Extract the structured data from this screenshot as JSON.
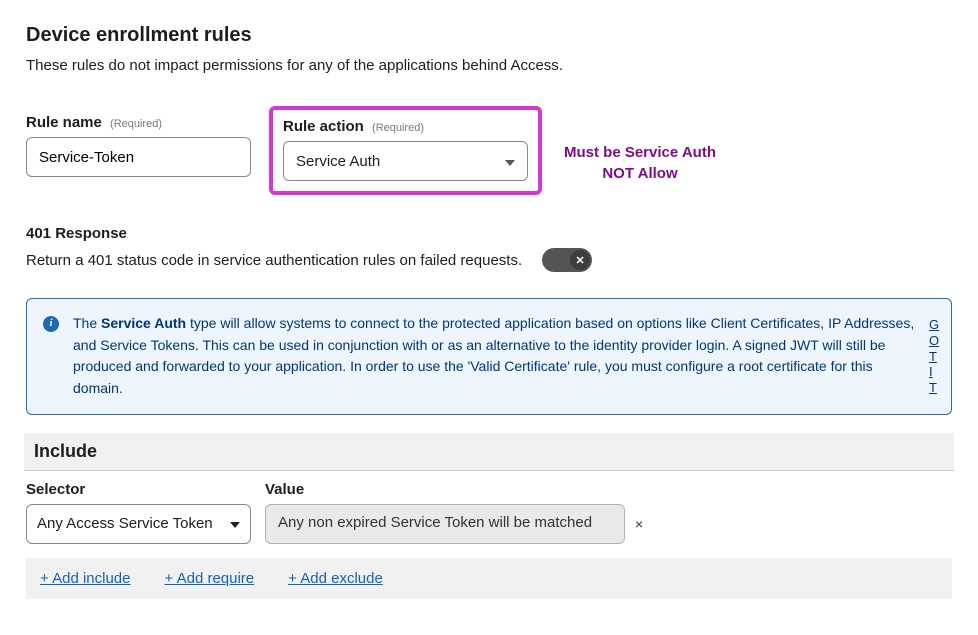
{
  "page": {
    "title": "Device enrollment rules",
    "subtitle": "These rules do not impact permissions for any of the applications behind Access."
  },
  "form": {
    "rule_name": {
      "label": "Rule name",
      "required_tag": "(Required)",
      "value": "Service-Token"
    },
    "rule_action": {
      "label": "Rule action",
      "required_tag": "(Required)",
      "value": "Service Auth"
    },
    "annotation": {
      "line1": "Must be Service Auth",
      "line2": "NOT Allow"
    }
  },
  "response401": {
    "heading": "401 Response",
    "description": "Return a 401 status code in service authentication rules on failed requests.",
    "toggle_state": "off",
    "toggle_icon_text": "✕"
  },
  "info_box": {
    "prefix": "The ",
    "bold": "Service Auth",
    "rest": " type will allow systems to connect to the protected application based on options like Client Certificates, IP Addresses, and Service Tokens. This can be used in conjunction with or as an alternative to the identity provider login. A signed JWT will still be produced and forwarded to your application. In order to use the 'Valid Certificate' rule, you must configure a root certificate for this domain.",
    "gotit": "GOT IT"
  },
  "include": {
    "heading": "Include",
    "selector_label": "Selector",
    "value_label": "Value",
    "selector_value": "Any Access Service Token",
    "value_text": "Any non expired Service Token will be matched",
    "remove_icon": "×"
  },
  "actions": {
    "add_include": "+ Add include",
    "add_require": "+ Add require",
    "add_exclude": "+ Add exclude"
  }
}
